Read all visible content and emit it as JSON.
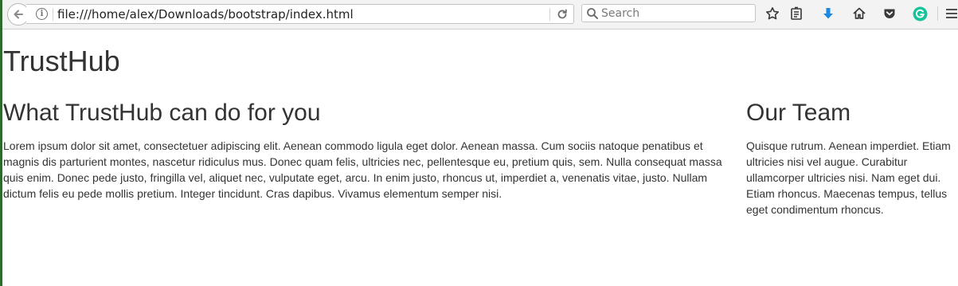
{
  "browser": {
    "url": "file:///home/alex/Downloads/bootstrap/index.html",
    "search_placeholder": "Search",
    "icons": {
      "back": "back-arrow-icon",
      "info": "info-icon",
      "reload": "reload-icon",
      "search": "search-icon",
      "bookmark": "star-icon",
      "library": "reading-list-icon",
      "downloads": "download-arrow-icon",
      "home": "home-icon",
      "pocket": "pocket-icon",
      "grammarly": "grammarly-icon",
      "menu": "hamburger-menu-icon"
    },
    "colors": {
      "toolbar_bg": "#f3f3f3",
      "download_blue": "#1e88e5",
      "grammarly_green": "#15c39a"
    }
  },
  "page": {
    "title": "TrustHub",
    "sections": [
      {
        "heading": "What TrustHub can do for you",
        "body": "Lorem ipsum dolor sit amet, consectetuer adipiscing elit. Aenean commodo ligula eget dolor. Aenean massa. Cum sociis natoque penatibus et magnis dis parturient montes, nascetur ridiculus mus. Donec quam felis, ultricies nec, pellentesque eu, pretium quis, sem. Nulla consequat massa quis enim. Donec pede justo, fringilla vel, aliquet nec, vulputate eget, arcu. In enim justo, rhoncus ut, imperdiet a, venenatis vitae, justo. Nullam dictum felis eu pede mollis pretium. Integer tincidunt. Cras dapibus. Vivamus elementum semper nisi."
      },
      {
        "heading": "Our Team",
        "body": "Quisque rutrum. Aenean imperdiet. Etiam ultricies nisi vel augue. Curabitur ullamcorper ultricies nisi. Nam eget dui. Etiam rhoncus. Maecenas tempus, tellus eget condimentum rhoncus."
      }
    ]
  }
}
